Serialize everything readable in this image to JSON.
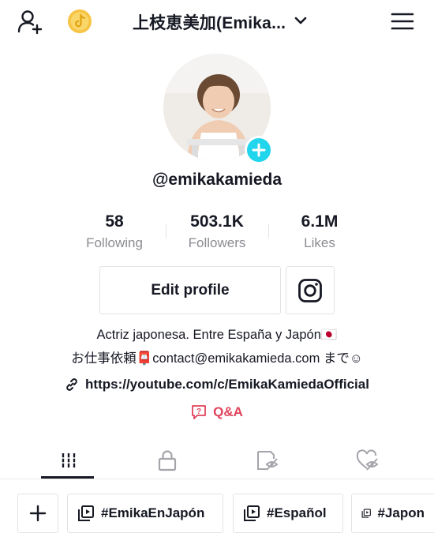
{
  "header": {
    "title": "上枝恵美加(Emika...",
    "add_user_icon": "add-user-icon",
    "coin_icon": "tiktok-coin-icon",
    "menu_icon": "hamburger-menu-icon"
  },
  "profile": {
    "username": "@emikakamieda",
    "stats": [
      {
        "value": "58",
        "label": "Following"
      },
      {
        "value": "503.1K",
        "label": "Followers"
      },
      {
        "value": "6.1M",
        "label": "Likes"
      }
    ],
    "edit_profile_label": "Edit profile",
    "bio_line1": "Actriz japonesa. Entre España y Japón🇯🇵",
    "bio_line2": "お仕事依頼📮contact@emikakamieda.com まで☺︎",
    "link": "https://youtube.com/c/EmikaKamiedaOfficial",
    "qa_label": "Q&A"
  },
  "tabs": [
    {
      "icon": "grid-icon"
    },
    {
      "icon": "lock-icon"
    },
    {
      "icon": "hidden-video-icon"
    },
    {
      "icon": "liked-hidden-icon"
    }
  ],
  "playlists": [
    {
      "label": "#EmikaEnJapón"
    },
    {
      "label": "#Español"
    },
    {
      "label": "#Japon"
    }
  ],
  "colors": {
    "accent_cyan": "#20d5ec",
    "qa_red": "#e0435b",
    "coin_gold": "#f6c343",
    "text": "#161823",
    "muted": "#8a8b91"
  }
}
